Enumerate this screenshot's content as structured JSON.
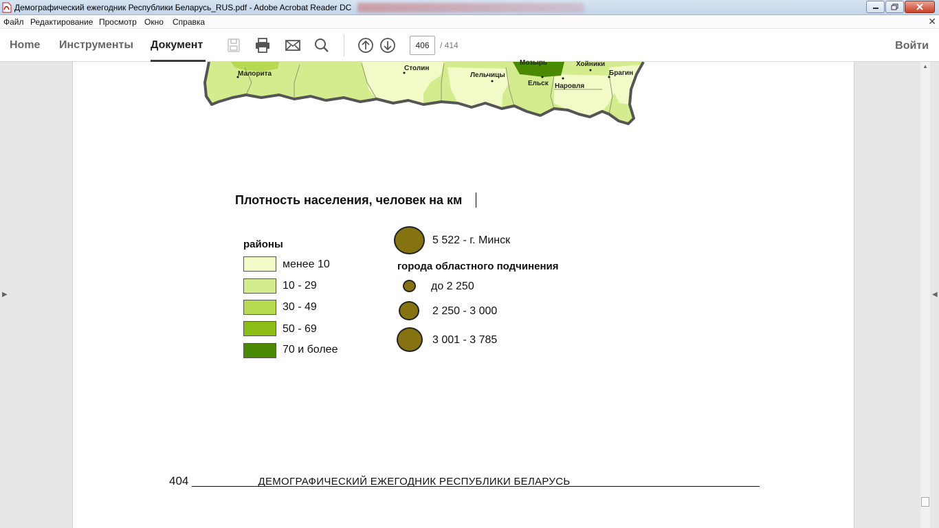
{
  "window": {
    "title": "Демографический ежегодник Республики Беларусь_RUS.pdf - Adobe Acrobat Reader DC"
  },
  "menu": [
    "Файл",
    "Редактирование",
    "Просмотр",
    "Окно",
    "Справка"
  ],
  "toolbar": {
    "tabs": [
      "Home",
      "Инструменты",
      "Документ"
    ],
    "active_tab": "Документ",
    "page_current": "406",
    "page_total": "/  414",
    "signin": "Войти"
  },
  "map": {
    "labels": [
      "Мозырь",
      "Хойники",
      "Брагин",
      "Малорита",
      "Столин",
      "Лельчицы",
      "Ельск",
      "Наровля"
    ],
    "colors": {
      "lt10": "#f2fbc8",
      "10_29": "#d4ec8e",
      "30_49": "#b8da52",
      "50_69": "#8cbc16",
      "70_plus": "#4a8a00"
    }
  },
  "legend": {
    "title": "Плотность населения, человек на км",
    "districts_title": "районы",
    "districts": [
      {
        "label": "менее 10",
        "color": "#f2fbc8"
      },
      {
        "label": "10 - 29",
        "color": "#d4ec8e"
      },
      {
        "label": "30 - 49",
        "color": "#b8da52"
      },
      {
        "label": "50 - 69",
        "color": "#8cbc16"
      },
      {
        "label": "70 и более",
        "color": "#4a8a00"
      }
    ],
    "minsk": "5 522 - г. Минск",
    "cities_title": "города областного подчинения",
    "cities": [
      "до 2 250",
      "2 250 - 3 000",
      "3 001 - 3 785"
    ],
    "circle_color": "#857312"
  },
  "footer": {
    "page_number": "404",
    "text": "ДЕМОГРАФИЧЕСКИЙ ЕЖЕГОДНИК РЕСПУБЛИКИ БЕЛАРУСЬ"
  }
}
